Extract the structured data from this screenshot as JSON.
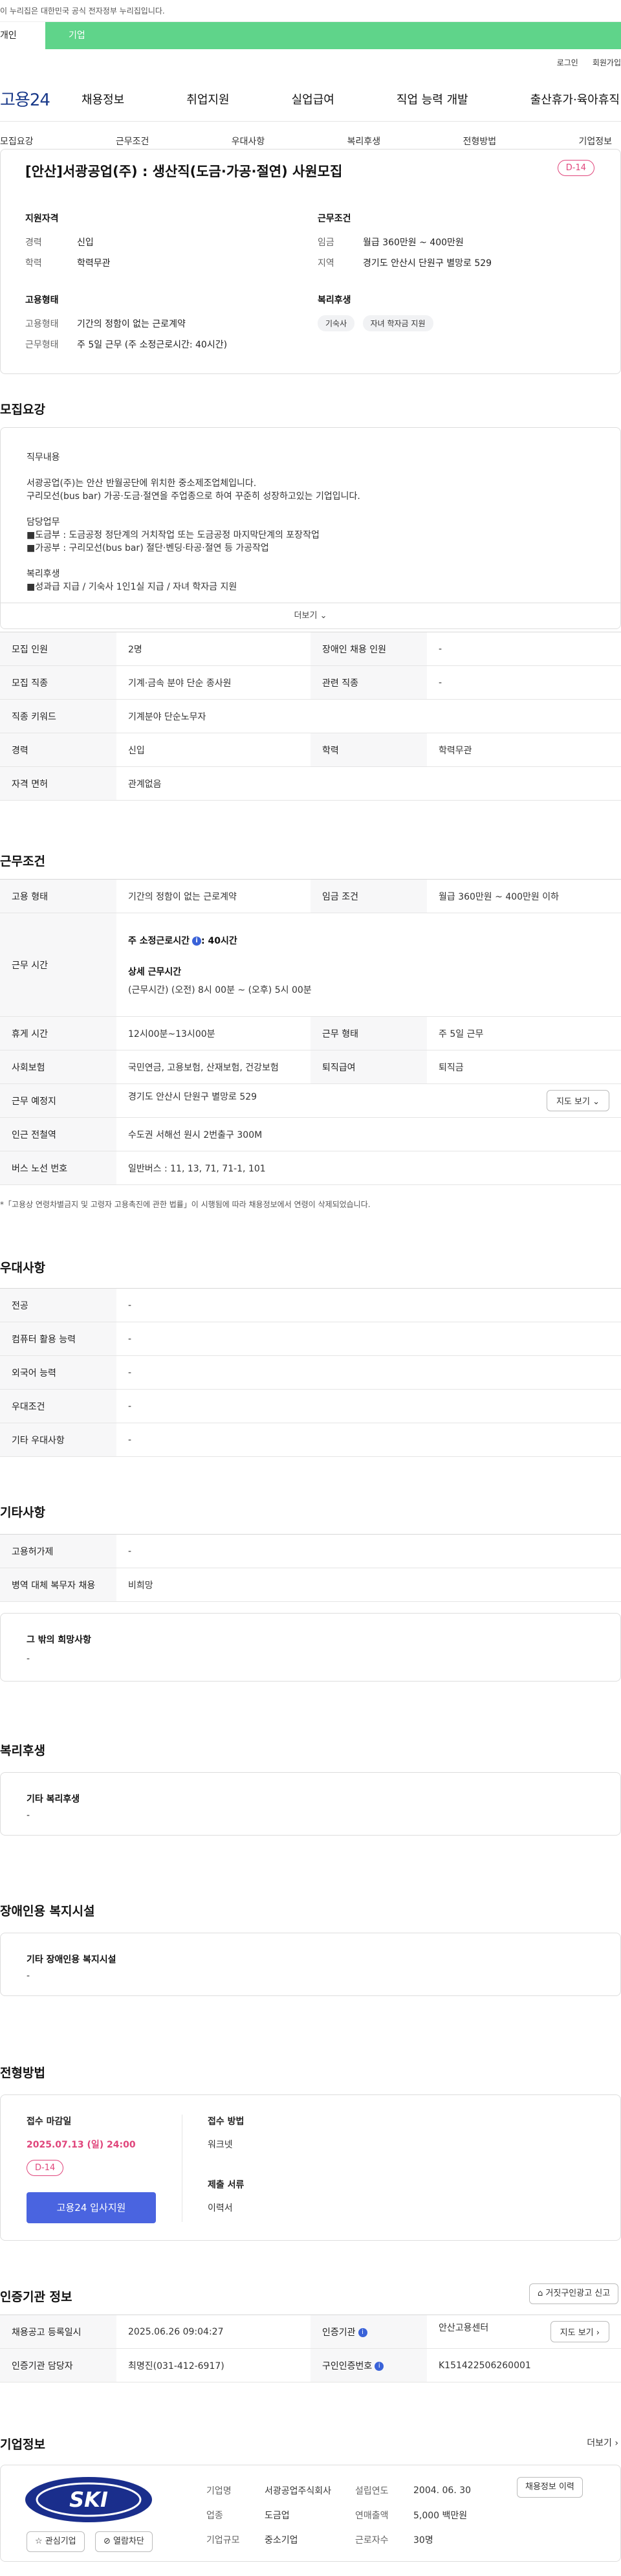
{
  "gov_banner": "이 누리집은 대한민국 공식 전자정부 누리집입니다.",
  "top_tabs": [
    "개인",
    "기업"
  ],
  "util_links": [
    "로그인",
    "회원가입"
  ],
  "logo": "고용24",
  "gnb": [
    "채용정보",
    "취업지원",
    "실업급여",
    "직업 능력 개발",
    "출산휴가·육아휴직"
  ],
  "snb": [
    "모집요강",
    "근무조건",
    "우대사항",
    "복리후생",
    "전형방법",
    "기업정보"
  ],
  "summary": {
    "title": "[안산]서광공업(주) : 생산직(도금·가공·절연) 사원모집",
    "dday": "D-14",
    "qual_title": "지원자격",
    "qual": [
      {
        "k": "경력",
        "v": "신입"
      },
      {
        "k": "학력",
        "v": "학력무관"
      }
    ],
    "cond_title": "근무조건",
    "cond": [
      {
        "k": "임금",
        "v": "월급 360만원 ~ 400만원"
      },
      {
        "k": "지역",
        "v": "경기도 안산시 단원구 별망로 529"
      }
    ],
    "emp_title": "고용형태",
    "emp": [
      {
        "k": "고용형태",
        "v": "기간의 정함이 없는 근로계약"
      },
      {
        "k": "근무형태",
        "v": "주 5일 근무 (주 소정근로시간: 40시간)"
      }
    ],
    "welfare_title": "복리후생",
    "welfare_chips": [
      "기숙사",
      "자녀 학자금 지원"
    ]
  },
  "section_recruit": "모집요강",
  "desc": {
    "lines": [
      "직무내용",
      "",
      "서광공업(주)는 안산 반월공단에 위치한 중소제조업체입니다.",
      "구리모선(bus bar) 가공·도금·절연을 주업종으로 하여 꾸준히 성장하고있는 기업입니다.",
      "",
      "담당업무",
      "■도금부 : 도금공정 정단계의 거치작업 또는 도금공정 마지막단계의 포장작업",
      "■가공부 : 구리모선(bus bar) 절단·벤딩·타공·절연 등 가공작업",
      "",
      "복리후생",
      "■성과급 지급 / 기숙사 1인1실 지급 / 자녀 학자금 지원"
    ],
    "more": "더보기"
  },
  "recruit_table": [
    [
      "모집 인원",
      "2명",
      "장애인 채용 인원",
      "-"
    ],
    [
      "모집 직종",
      "기계·금속 분야 단순 종사원",
      "관련 직종",
      "-"
    ],
    [
      "직종 키워드",
      "기계분야 단순노무자"
    ],
    [
      "경력",
      "신입",
      "학력",
      "학력무관"
    ],
    [
      "자격 면허",
      "관계없음"
    ]
  ],
  "section_conditions": "근무조건",
  "conditions": {
    "emp_type_label": "고용 형태",
    "emp_type": "기간의 정함이 없는 근로계약",
    "wage_label": "임금 조건",
    "wage": "월급 360만원 ~ 400만원 이하",
    "hours_label": "근무 시간",
    "weekly": "주 소정근로시간",
    "weekly_val": ": 40시간",
    "detail_title": "상세 근무시간",
    "detail": "(근무시간) (오전) 8시 00분 ~ (오후) 5시 00분",
    "break_label": "휴게 시간",
    "break": "12시00분~13시00분",
    "shift_label": "근무 형태",
    "shift": "주 5일 근무",
    "insurance_label": "사회보험",
    "insurance": "국민연금, 고용보험, 산재보험, 건강보험",
    "retire_label": "퇴직급여",
    "retire": "퇴직금",
    "place_label": "근무 예정지",
    "place": "경기도 안산시 단원구 별망로 529",
    "map_btn": "지도 보기",
    "subway_label": "인근 전철역",
    "subway": "수도권 서해선 원시 2번출구 300M",
    "bus_label": "버스 노선 번호",
    "bus": "일반버스 : 11, 13, 71, 71-1, 101",
    "note": "*「고용상 연령차별금지 및 고령자 고용촉진에 관한 법률」이 시행됨에 따라 채용정보에서 연령이 삭제되었습니다."
  },
  "section_pref": "우대사항",
  "pref_table": [
    [
      "전공",
      "-"
    ],
    [
      "컴퓨터 활용 능력",
      "-"
    ],
    [
      "외국어 능력",
      "-"
    ],
    [
      "우대조건",
      "-"
    ],
    [
      "기타 우대사항",
      "-"
    ]
  ],
  "section_etc": "기타사항",
  "etc_table": [
    [
      "고용허가제",
      "-"
    ],
    [
      "병역 대체 복무자 채용",
      "비희망"
    ]
  ],
  "etc_box": {
    "title": "그 밖의 희망사항",
    "value": "-"
  },
  "section_welfare": "복리후생",
  "welfare_box": {
    "title": "기타 복리후생",
    "value": "-"
  },
  "section_disabled": "장애인용 복지시설",
  "disabled_box": {
    "title": "기타 장애인용 복지시설",
    "value": "-"
  },
  "section_process": "전형방법",
  "apply": {
    "deadline_label": "접수 마감일",
    "deadline": "2025.07.13 (일) 24:00",
    "dday": "D-14",
    "btn": "고용24 입사지원",
    "method_label": "접수 방법",
    "method": "워크넷",
    "docs_label": "제출 서류",
    "docs": "이력서"
  },
  "section_cert": "인증기관 정보",
  "report_btn": "거짓구인광고 신고",
  "cert_table": {
    "reg_label": "채용공고 등록일시",
    "reg": "2025.06.26 09:04:27",
    "agency_label": "인증기관",
    "agency": "안산고용센터",
    "map_btn": "지도 보기",
    "manager_label": "인증기관 담당자",
    "manager": "최명진(031-412-6917)",
    "id_label": "구인인증번호",
    "id": "K151422506260001"
  },
  "section_company": "기업정보",
  "company_more": "더보기",
  "company": {
    "logo_text": "SKI",
    "fav_btn": "관심기업",
    "block_btn": "열람차단",
    "name_label": "기업명",
    "name": "서광공업주식회사",
    "founded_label": "설립연도",
    "founded": "2004. 06. 30",
    "industry_label": "업종",
    "industry": "도금업",
    "sales_label": "연매출액",
    "sales": "5,000 백만원",
    "size_label": "기업규모",
    "size": "중소기업",
    "staff_label": "근로자수",
    "staff": "30명",
    "history_btn": "채용정보 이력"
  }
}
